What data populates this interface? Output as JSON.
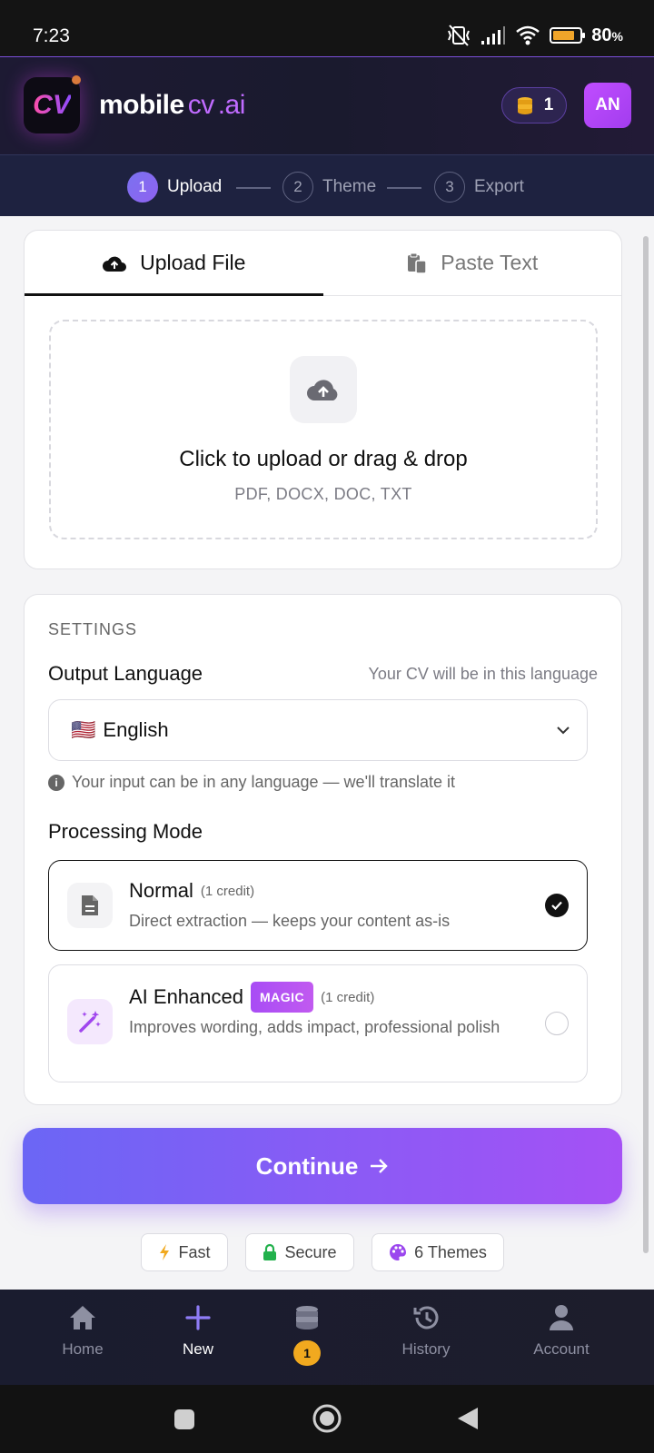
{
  "status_bar": {
    "time": "7:23",
    "battery_level": 0.8,
    "battery_percent": "80",
    "battery_percent_suffix": "%"
  },
  "header": {
    "logo_text": "CV",
    "brand": {
      "part1": "mobile",
      "part2": "cv",
      "part3": ".ai"
    },
    "credits": "1",
    "avatar_initials": "AN"
  },
  "stepper": {
    "steps": [
      {
        "num": "1",
        "label": "Upload"
      },
      {
        "num": "2",
        "label": "Theme"
      },
      {
        "num": "3",
        "label": "Export"
      }
    ]
  },
  "upload_card": {
    "tabs": [
      {
        "label": "Upload File"
      },
      {
        "label": "Paste Text"
      }
    ],
    "dropzone": {
      "title": "Click to upload or drag & drop",
      "formats": "PDF, DOCX, DOC, TXT"
    }
  },
  "settings": {
    "section_label": "SETTINGS",
    "output_language": {
      "title": "Output Language",
      "hint": "Your CV will be in this language",
      "selected_flag": "🇺🇸",
      "selected": "English",
      "info": "Your input can be in any language — we'll translate it"
    },
    "processing_mode": {
      "title": "Processing Mode",
      "modes": [
        {
          "title": "Normal",
          "credit": "(1 credit)",
          "desc": "Direct extraction — keeps your content as-is",
          "selected": true
        },
        {
          "title": "AI Enhanced",
          "badge": "MAGIC",
          "credit": "(1 credit)",
          "desc": "Improves wording, adds impact, professional polish",
          "selected": false
        }
      ]
    }
  },
  "continue_label": "Continue",
  "features": [
    {
      "label": "Fast"
    },
    {
      "label": "Secure"
    },
    {
      "label": "6 Themes"
    }
  ],
  "bottom_nav": {
    "items": [
      {
        "label": "Home"
      },
      {
        "label": "New"
      },
      {
        "badge": "1"
      },
      {
        "label": "History"
      },
      {
        "label": "Account"
      }
    ]
  },
  "colors": {
    "accent": "#7a6cf3",
    "magic": "#b153f3",
    "badge": "#f1a91f"
  }
}
